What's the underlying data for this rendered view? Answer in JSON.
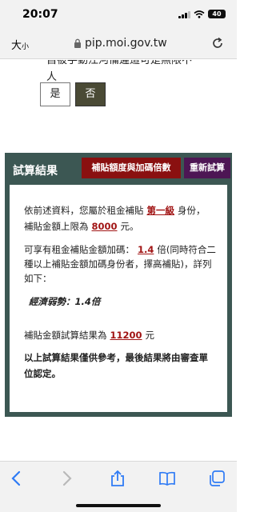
{
  "status": {
    "time": "20:07",
    "battery": "40"
  },
  "browser": {
    "text_size_label": "大",
    "text_size_small": "小",
    "url": "pip.moi.gov.tw"
  },
  "question": {
    "cut_text": "自被手動江河備違這可是無限不",
    "tail": "人",
    "yes": "是",
    "no": "否"
  },
  "result": {
    "title": "試算結果",
    "btn_multiplier": "補貼額度與加碼倍數",
    "btn_recalc": "重新試算",
    "p1_a": "依前述資料，您屬於租金補貼",
    "p1_level": "第一級",
    "p1_b": "身份， 補貼金額上限為",
    "p1_amount": "8000",
    "p1_c": "元。",
    "p2_a": "可享有租金補貼金額加碼：",
    "p2_mult": "1.4",
    "p2_b": "倍(同時符合二種以上補貼金額加碼身份者，擇高補貼)，詳列如下：",
    "p3": "經濟弱勢：1.4倍",
    "p4_a": "補貼金額試算結果為",
    "p4_amount": "11200",
    "p4_b": "元",
    "p5": "以上試算結果僅供參考，最後結果將由審查單位認定。"
  },
  "toolbar": {
    "back_icon": "chevron-left-icon",
    "forward_icon": "chevron-right-icon",
    "share_icon": "share-icon",
    "bookmarks_icon": "book-icon",
    "tabs_icon": "tabs-icon"
  },
  "colors": {
    "accent": "#2f7bf5",
    "section_bg": "#3c5753",
    "btn_red": "#8a1010",
    "btn_purple": "#4d1654",
    "highlight": "#a11414"
  }
}
